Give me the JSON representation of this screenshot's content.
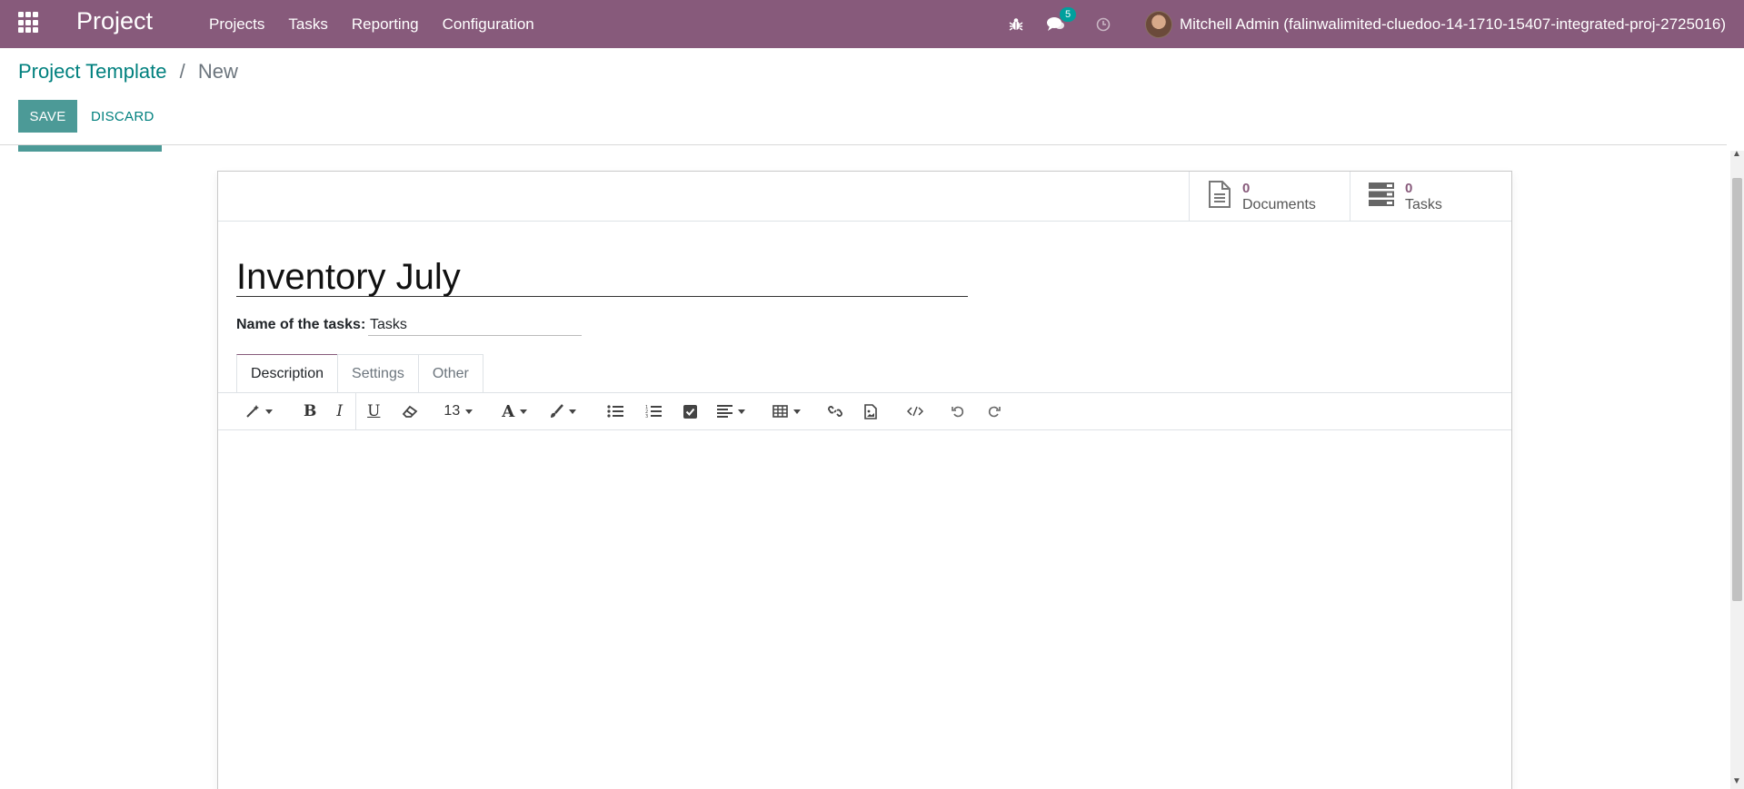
{
  "navbar": {
    "brand": "Project",
    "menu": [
      "Projects",
      "Tasks",
      "Reporting",
      "Configuration"
    ],
    "messages_count": "5",
    "user_name": "Mitchell Admin (falinwalimited-cluedoo-14-1710-15407-integrated-proj-2725016)"
  },
  "breadcrumb": {
    "parent": "Project Template",
    "separator": "/",
    "current": "New"
  },
  "actions": {
    "save": "SAVE",
    "discard": "DISCARD"
  },
  "stat_buttons": [
    {
      "value": "0",
      "label": "Documents",
      "icon": "document-icon"
    },
    {
      "value": "0",
      "label": "Tasks",
      "icon": "tasks-icon"
    }
  ],
  "form": {
    "name": "Inventory July",
    "task_label": "Name of the tasks:",
    "task_value": "Tasks"
  },
  "tabs": [
    "Description",
    "Settings",
    "Other"
  ],
  "editor_toolbar": {
    "font_size": "13"
  },
  "colors": {
    "brand": "#875a7b",
    "primary": "#00a09d",
    "link": "#00807e"
  }
}
